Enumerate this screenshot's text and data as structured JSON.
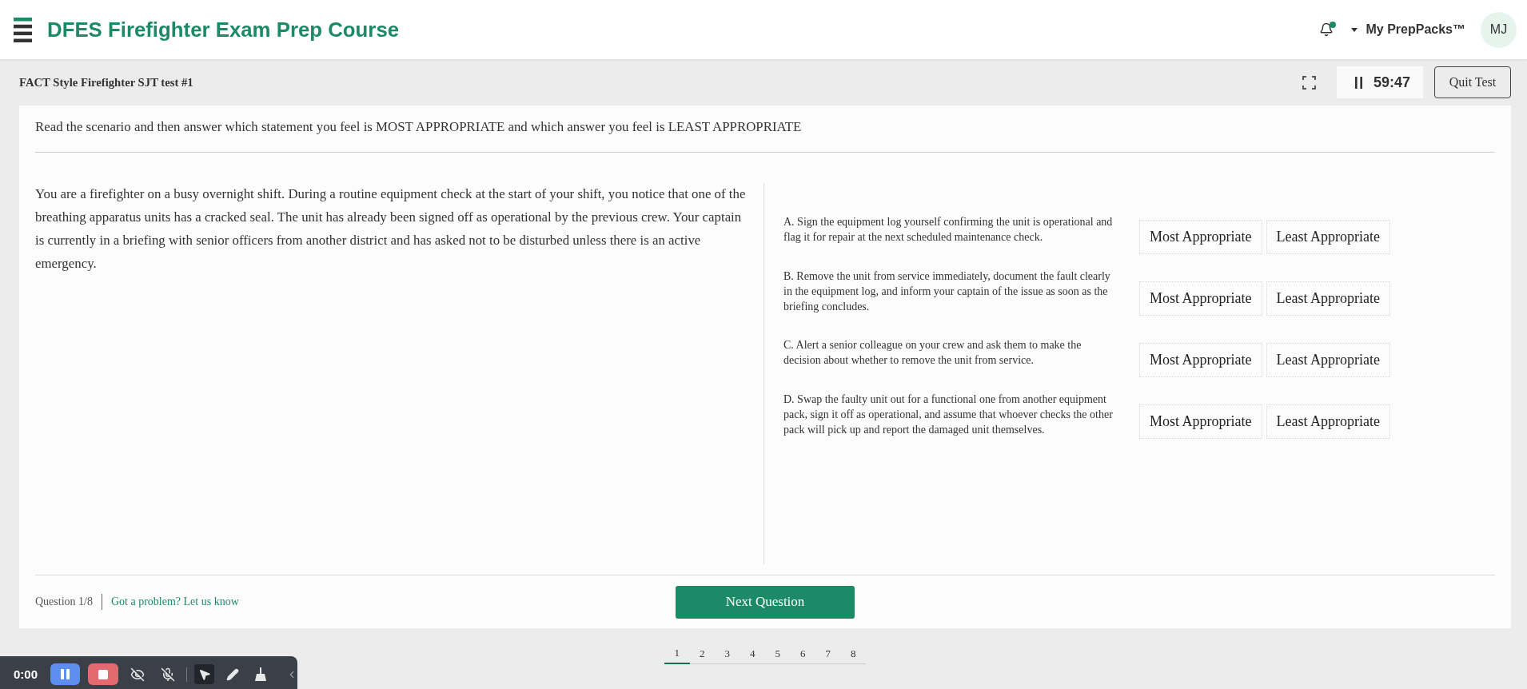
{
  "header": {
    "title": "DFES Firefighter Exam Prep Course",
    "notification_unread": true,
    "account_menu": "My PrepPacks™",
    "avatar": "MJ"
  },
  "test_bar": {
    "title": "FACT Style Firefighter SJT test #1",
    "timer": "59:47",
    "quit_button": "Quit Test"
  },
  "instructions": "Read the scenario and then answer which statement you feel is MOST APPROPRIATE and which answer you feel is LEAST APPROPRIATE",
  "scenario": "You are a firefighter on a busy overnight shift. During a routine equipment check at the start of your shift, you notice that one of the breathing apparatus units has a cracked seal. The unit has already been signed off as operational by the previous crew. Your captain is currently in a briefing with senior officers from another district and has asked not to be disturbed unless there is an active emergency.",
  "options": [
    {
      "text": "A. Sign the equipment log yourself confirming the unit is operational and flag it for repair at the next scheduled maintenance check.",
      "buttons": [
        {
          "label": "Most Appropriate",
          "selected": false
        },
        {
          "label": "Least Appropriate",
          "selected": false
        }
      ]
    },
    {
      "text": "B. Remove the unit from service immediately, document the fault clearly in the equipment log, and inform your captain of the issue as soon as the briefing concludes.",
      "buttons": [
        {
          "label": "Most Appropriate",
          "selected": false
        },
        {
          "label": "Least Appropriate",
          "selected": false
        }
      ]
    },
    {
      "text": "C. Alert a senior colleague on your crew and ask them to make the decision about whether to remove the unit from service.",
      "buttons": [
        {
          "label": "Most Appropriate",
          "selected": false
        },
        {
          "label": "Least Appropriate",
          "selected": false
        }
      ]
    },
    {
      "text": "D. Swap the faulty unit out for a functional one from another equipment pack, sign it off as operational, and assume that whoever checks the other pack will pick up and report the damaged unit themselves.",
      "buttons": [
        {
          "label": "Most Appropriate",
          "selected": false
        },
        {
          "label": "Least Appropriate",
          "selected": false
        }
      ]
    }
  ],
  "footer": {
    "question": "Question 1/8",
    "report_link": "Got a problem? Let us know",
    "next_button": "Next Question"
  },
  "pagination": [
    {
      "label": "1",
      "selected": true
    },
    {
      "label": "2",
      "selected": false
    },
    {
      "label": "3",
      "selected": false
    },
    {
      "label": "4",
      "selected": false
    },
    {
      "label": "5",
      "selected": false
    },
    {
      "label": "6",
      "selected": false
    },
    {
      "label": "7",
      "selected": false
    },
    {
      "label": "8",
      "selected": false
    }
  ],
  "recorder_toolbar": {
    "time": "0:00",
    "toggles": [
      {
        "kind": "eye",
        "on": false
      },
      {
        "kind": "mic",
        "on": false
      }
    ],
    "tools": [
      {
        "kind": "pointer",
        "selected": true
      },
      {
        "kind": "pen",
        "selected": false
      },
      {
        "kind": "broom",
        "selected": false
      }
    ]
  }
}
